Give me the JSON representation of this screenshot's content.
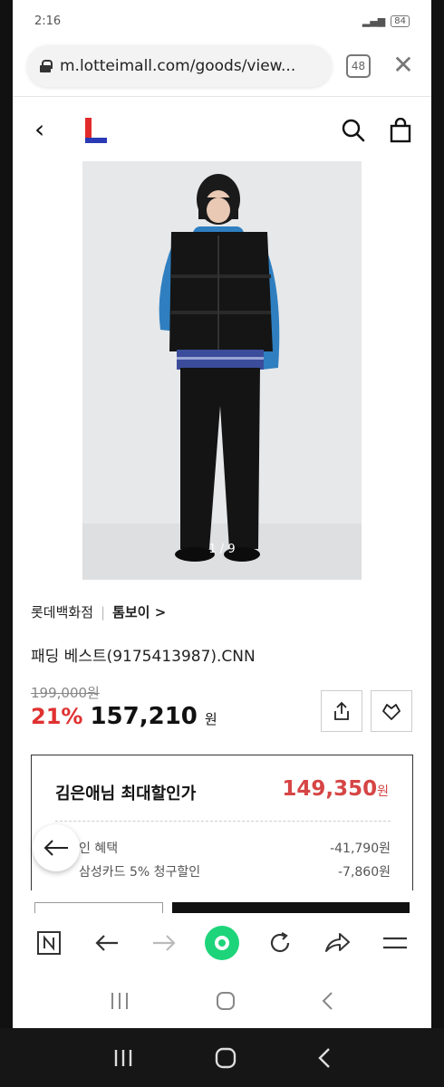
{
  "status_bar": {
    "time": "2:16",
    "battery": "84"
  },
  "browser": {
    "url": "m.lotteimall.com/goods/view...",
    "tab_count": "48"
  },
  "header": {
    "logo": "L"
  },
  "product": {
    "image_indicator": "1 / 9",
    "store": "롯데백화점",
    "brand": "톰보이 >",
    "name": "패딩 베스트(9175413987).CNN",
    "original_price": "199,000원",
    "discount": "21%",
    "price": "157,210",
    "price_unit": "원"
  },
  "benefit_box": {
    "label": "김은애님 최대할인가",
    "best_price": "149,350",
    "best_unit": "원",
    "rows": [
      {
        "label": "인 혜택",
        "value": "-41,790원"
      },
      {
        "label": "삼성카드 5% 청구할인",
        "value": "-7,860원"
      }
    ]
  },
  "colors": {
    "accent_red": "#e03131",
    "best_price_red": "#d64545",
    "lotte_red": "#e32a2a",
    "lotte_blue": "#2a3ab5",
    "share_green": "#1ed47a"
  },
  "icons": [
    "lock-icon",
    "close-icon",
    "back-icon",
    "search-icon",
    "bag-icon",
    "share-icon",
    "heart-icon",
    "arrow-left-icon",
    "n-icon",
    "forward-icon",
    "record-icon",
    "reload-icon",
    "send-icon",
    "menu-icon",
    "recents-icon",
    "home-icon"
  ]
}
